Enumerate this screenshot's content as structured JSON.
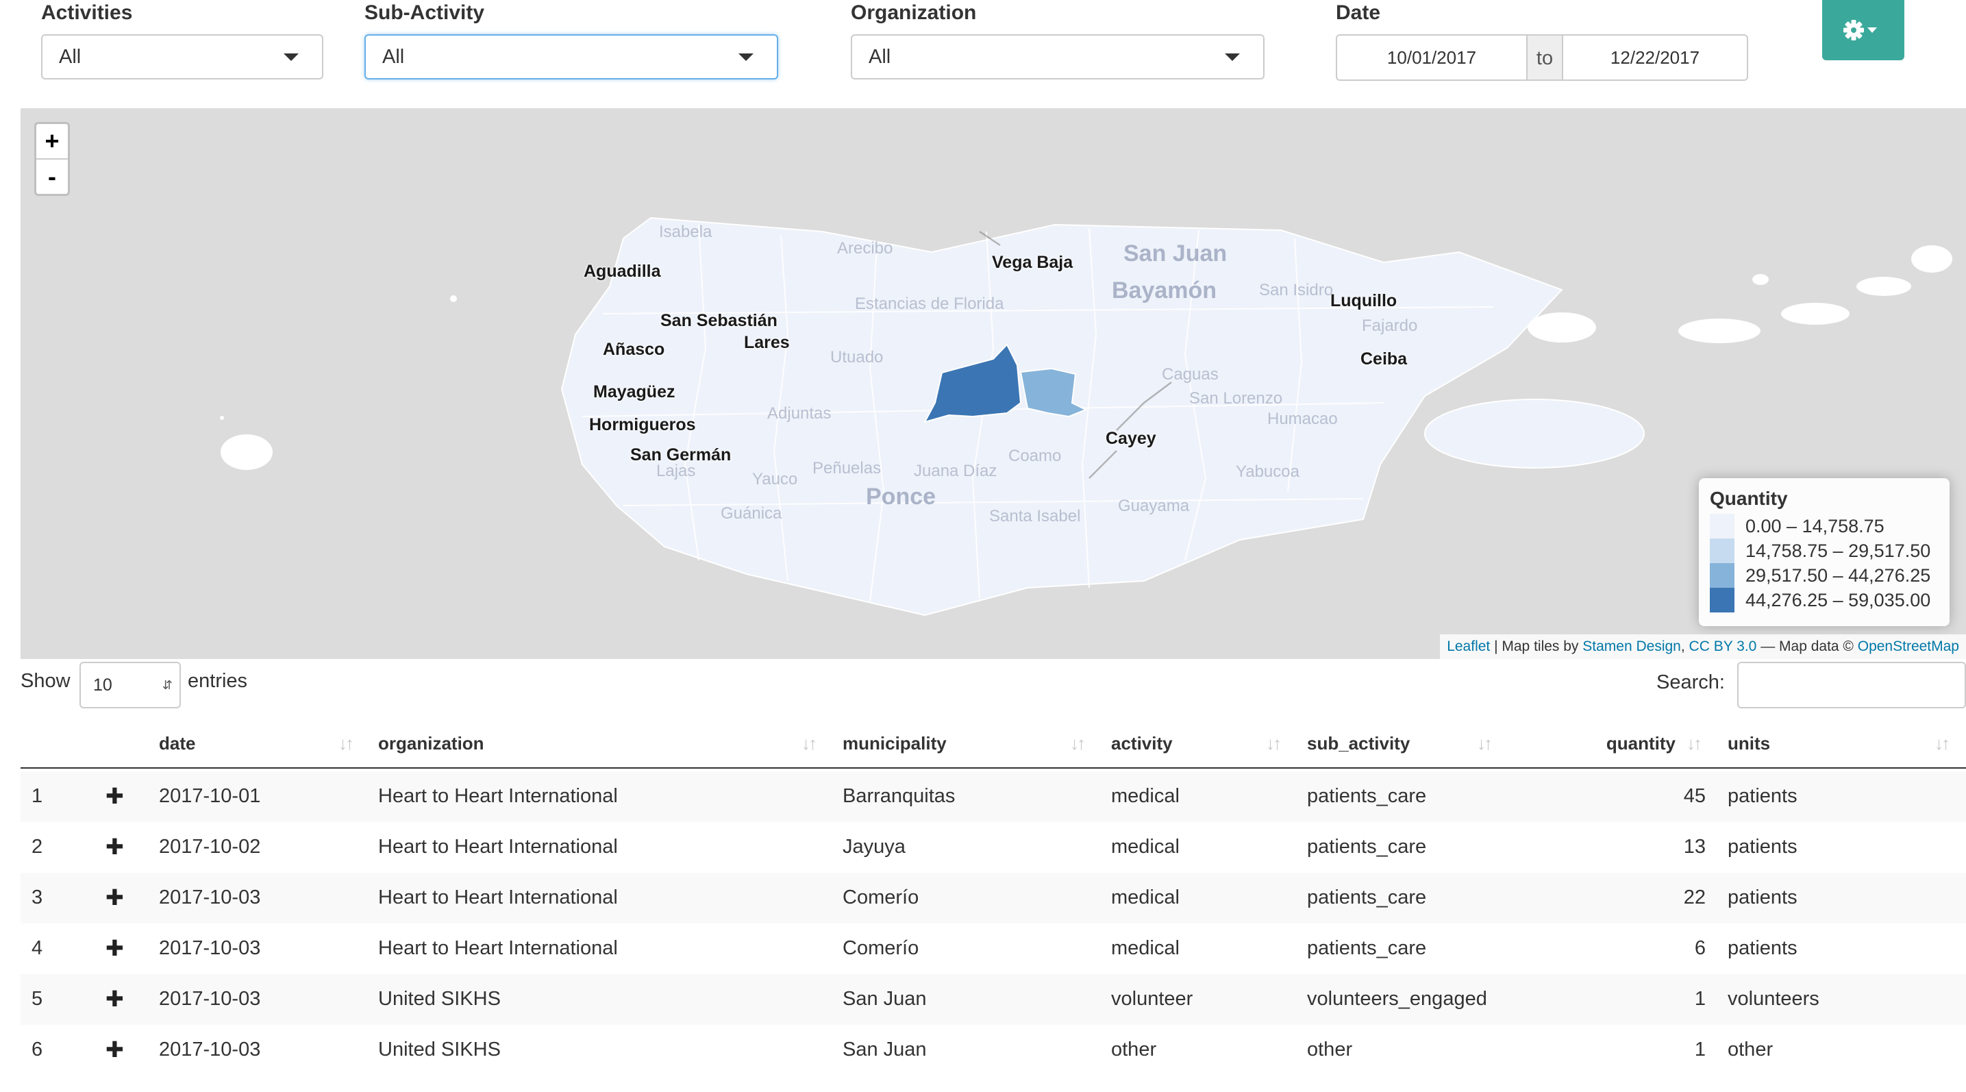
{
  "filters": {
    "activities": {
      "label": "Activities",
      "value": "All"
    },
    "sub_activity": {
      "label": "Sub-Activity",
      "value": "All"
    },
    "organization": {
      "label": "Organization",
      "value": "All"
    },
    "date": {
      "label": "Date",
      "from": "10/01/2017",
      "separator": "to",
      "to": "12/22/2017"
    }
  },
  "settings_button": {
    "icon": "gear-icon"
  },
  "map": {
    "zoom_in": "+",
    "zoom_out": "-",
    "places": [
      {
        "name": "Isabela"
      },
      {
        "name": "Arecibo"
      },
      {
        "name": "Vega Baja"
      },
      {
        "name": "San Juan"
      },
      {
        "name": "Bayamón"
      },
      {
        "name": "San Isidro"
      },
      {
        "name": "Luquillo"
      },
      {
        "name": "Fajardo"
      },
      {
        "name": "Aguadilla"
      },
      {
        "name": "San Sebastián"
      },
      {
        "name": "Estancias de Florida"
      },
      {
        "name": "Lares"
      },
      {
        "name": "Añasco"
      },
      {
        "name": "Utuado"
      },
      {
        "name": "Caguas"
      },
      {
        "name": "Ceiba"
      },
      {
        "name": "San Lorenzo"
      },
      {
        "name": "Mayagüez"
      },
      {
        "name": "Adjuntas"
      },
      {
        "name": "Humacao"
      },
      {
        "name": "Hormigueros"
      },
      {
        "name": "Cayey"
      },
      {
        "name": "San Germán"
      },
      {
        "name": "Coamo"
      },
      {
        "name": "Lajas"
      },
      {
        "name": "Peñuelas"
      },
      {
        "name": "Juana Díaz"
      },
      {
        "name": "Yauco"
      },
      {
        "name": "Yabucoa"
      },
      {
        "name": "Ponce"
      },
      {
        "name": "Guánica"
      },
      {
        "name": "Guayama"
      },
      {
        "name": "Santa Isabel"
      }
    ],
    "legend": {
      "title": "Quantity",
      "items": [
        {
          "label": "0.00 – 14,758.75",
          "color": "#eef2fa"
        },
        {
          "label": "14,758.75 – 29,517.50",
          "color": "#c6dbef"
        },
        {
          "label": "29,517.50 – 44,276.25",
          "color": "#86b3d9"
        },
        {
          "label": "44,276.25 – 59,035.00",
          "color": "#3b75b3"
        }
      ]
    },
    "attribution": {
      "leaflet": "Leaflet",
      "sep1": " | Map tiles by ",
      "stamen": "Stamen Design",
      "comma": ", ",
      "license": "CC BY 3.0",
      "sep2": " — Map data © ",
      "osm": "OpenStreetMap"
    }
  },
  "table_controls": {
    "show": "Show",
    "entries_value": "10",
    "entries": "entries",
    "search_label": "Search:",
    "search_value": ""
  },
  "table": {
    "columns": [
      "date",
      "organization",
      "municipality",
      "activity",
      "sub_activity",
      "quantity",
      "units"
    ],
    "rows": [
      {
        "n": "1",
        "date": "2017-10-01",
        "organization": "Heart to Heart International",
        "municipality": "Barranquitas",
        "activity": "medical",
        "sub_activity": "patients_care",
        "quantity": "45",
        "units": "patients"
      },
      {
        "n": "2",
        "date": "2017-10-02",
        "organization": "Heart to Heart International",
        "municipality": "Jayuya",
        "activity": "medical",
        "sub_activity": "patients_care",
        "quantity": "13",
        "units": "patients"
      },
      {
        "n": "3",
        "date": "2017-10-03",
        "organization": "Heart to Heart International",
        "municipality": "Comerío",
        "activity": "medical",
        "sub_activity": "patients_care",
        "quantity": "22",
        "units": "patients"
      },
      {
        "n": "4",
        "date": "2017-10-03",
        "organization": "Heart to Heart International",
        "municipality": "Comerío",
        "activity": "medical",
        "sub_activity": "patients_care",
        "quantity": "6",
        "units": "patients"
      },
      {
        "n": "5",
        "date": "2017-10-03",
        "organization": "United SIKHS",
        "municipality": "San Juan",
        "activity": "volunteer",
        "sub_activity": "volunteers_engaged",
        "quantity": "1",
        "units": "volunteers"
      },
      {
        "n": "6",
        "date": "2017-10-03",
        "organization": "United SIKHS",
        "municipality": "San Juan",
        "activity": "other",
        "sub_activity": "other",
        "quantity": "1",
        "units": "other"
      }
    ]
  }
}
